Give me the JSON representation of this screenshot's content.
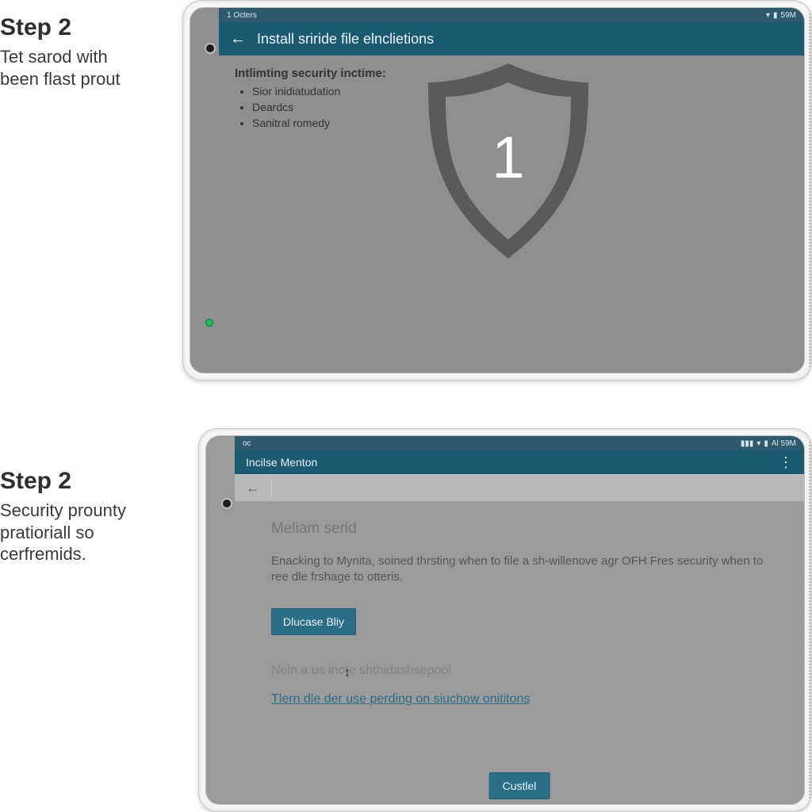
{
  "steps": {
    "top": {
      "title": "Step 2",
      "body_line1": "Tet sarod with",
      "body_line2": "been flast prout"
    },
    "bottom": {
      "title": "Step 2",
      "body_line1": "Security prounty",
      "body_line2": "pratioriall so",
      "body_line3": "cerfremids."
    }
  },
  "screen1": {
    "status_left": "1 Octers",
    "status_right_time": "59M",
    "actionbar_title": "Install sriride file elnclietions",
    "content_heading": "Intlimting security inctime:",
    "bullets": [
      "Sior inidiatudation",
      "Deardcs",
      "Sanitral romedy"
    ],
    "shield_number": "1"
  },
  "screen2": {
    "status_left": "oc",
    "status_right": "Al 59M",
    "actionbar_title": "Incilse Menton",
    "overflow": "⋮",
    "section_title": "Meliam serid",
    "description": "Enacking to Mynita, soined thrsting when to file a sh-willenove agr OFH Fres security when to ree dle frshage to otteris.",
    "button_primary": "Dlucase Bliy",
    "note_text": "Neln a us inote shthidashsepool",
    "link_text": "Tlern dle der use perding on siuchow onititons",
    "button_bottom": "Custlel"
  },
  "colors": {
    "accent": "#1c5a72",
    "button": "#2a6e88",
    "screen_bg": "#8f8f8f"
  }
}
